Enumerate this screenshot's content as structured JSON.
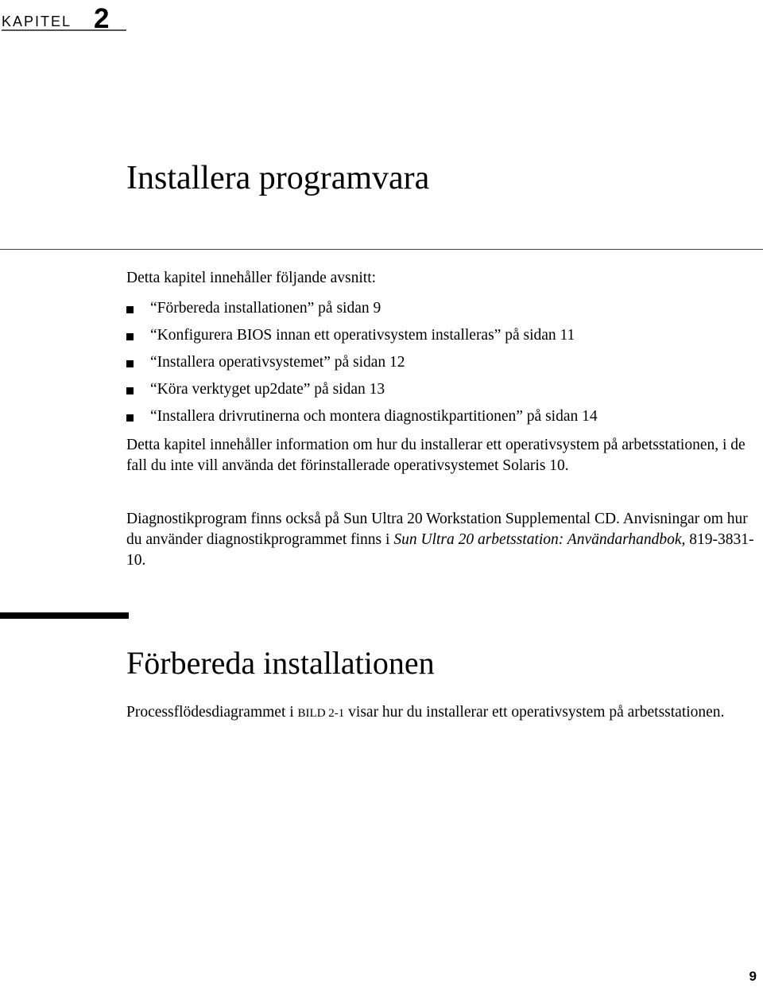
{
  "header": {
    "chapter_word": "KAPITEL",
    "chapter_number": "2"
  },
  "title": "Installera programvara",
  "intro": "Detta kapitel innehåller följande avsnitt:",
  "toc": [
    {
      "title": "“Förbereda installationen”",
      "page_ref": "på sidan 9"
    },
    {
      "title": "“Konfigurera BIOS innan ett operativsystem installeras”",
      "page_ref": "på sidan 11"
    },
    {
      "title": "“Installera operativsystemet”",
      "page_ref": "på sidan 12"
    },
    {
      "title": "“Köra verktyget up2date”",
      "page_ref": "på sidan 13"
    },
    {
      "title": "“Installera drivrutinerna och montera diagnostikpartitionen”",
      "page_ref": "på sidan 14"
    }
  ],
  "paragraph1": "Detta kapitel innehåller information om hur du installerar ett operativsystem på arbetsstationen, i de fall du inte vill använda det förinstallerade operativsystemet Solaris 10.",
  "paragraph2": {
    "text_before": "Diagnostikprogram finns också på Sun Ultra 20 Workstation Supplemental CD. Anvisningar om hur du använder diagnostikprogrammet finns i ",
    "book_title": "Sun Ultra 20 arbetsstation: Användarhandbok,",
    "text_after": " 819-3831-10."
  },
  "section": {
    "heading": "Förbereda installationen",
    "text_before": "Processflödesdiagrammet i ",
    "figure_ref": "BILD 2-1",
    "text_after": " visar hur du installerar ett operativsystem på arbetsstationen."
  },
  "footer": {
    "page_number": "9"
  }
}
